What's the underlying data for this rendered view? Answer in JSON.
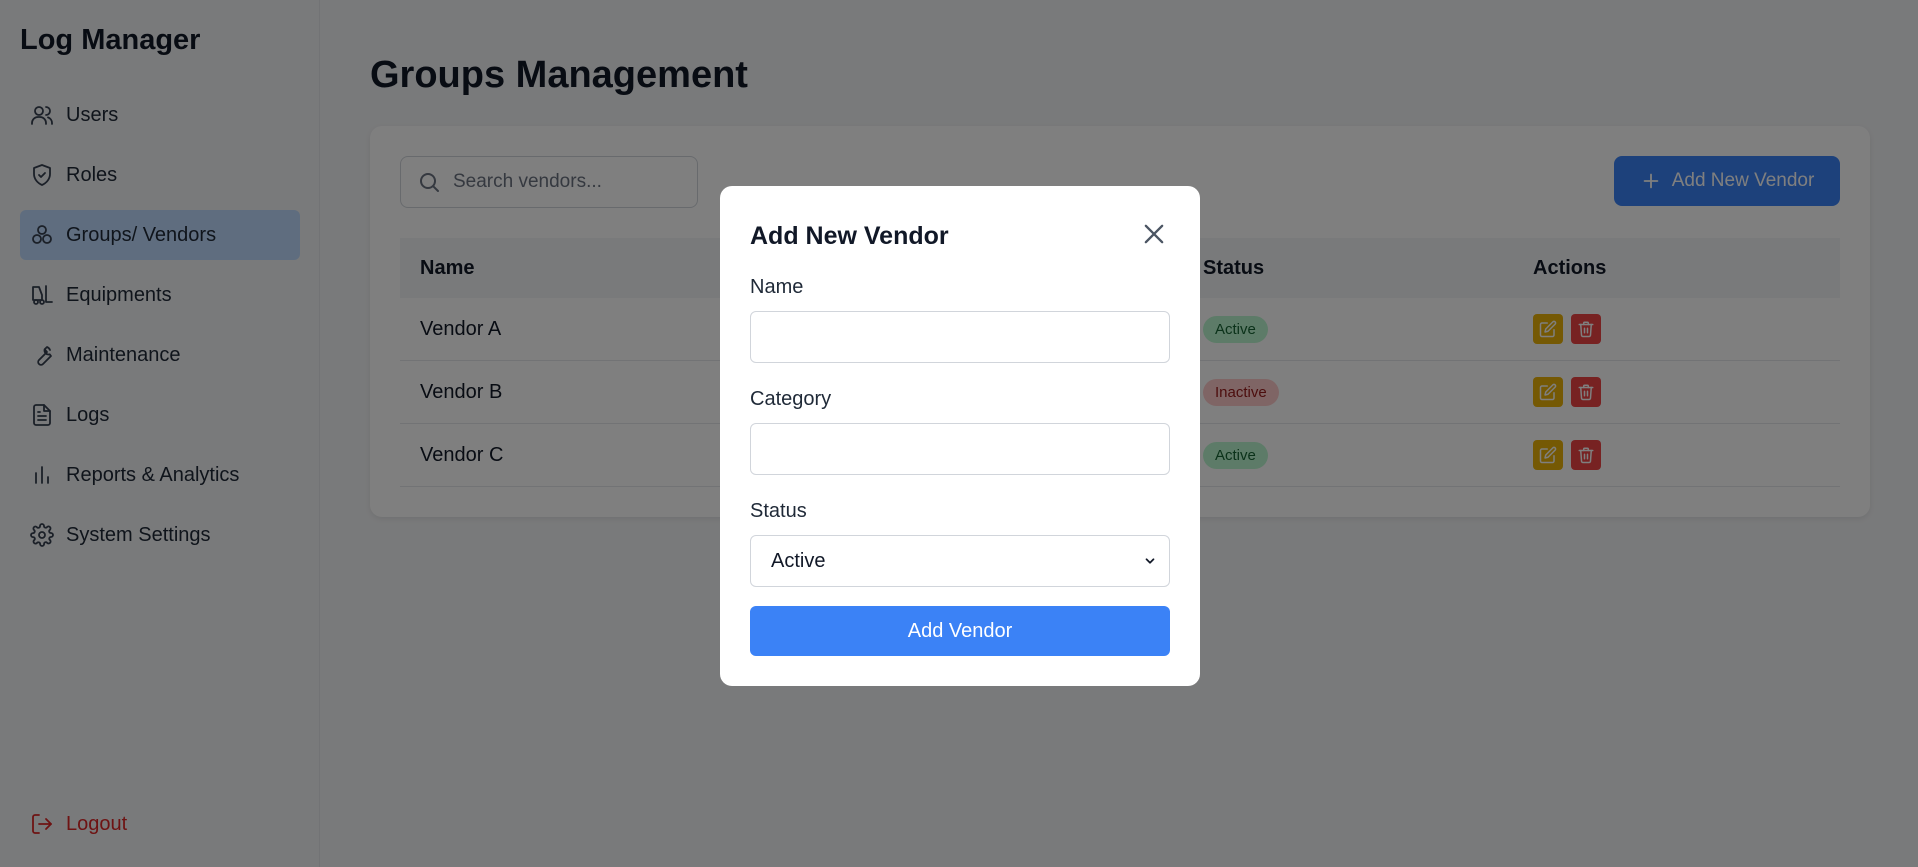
{
  "app": {
    "title": "Log Manager"
  },
  "sidebar": {
    "items": [
      {
        "label": "Users",
        "icon": "users-icon"
      },
      {
        "label": "Roles",
        "icon": "shield-icon"
      },
      {
        "label": "Groups/ Vendors",
        "icon": "groups-icon",
        "active": true
      },
      {
        "label": "Equipments",
        "icon": "forklift-icon"
      },
      {
        "label": "Maintenance",
        "icon": "wrench-icon"
      },
      {
        "label": "Logs",
        "icon": "file-text-icon"
      },
      {
        "label": "Reports & Analytics",
        "icon": "bar-chart-icon"
      },
      {
        "label": "System Settings",
        "icon": "gear-icon"
      }
    ],
    "logout_label": "Logout"
  },
  "main": {
    "title": "Groups Management",
    "search": {
      "placeholder": "Search vendors..."
    },
    "add_button_label": "Add New Vendor",
    "table": {
      "headers": {
        "name": "Name",
        "status": "Status",
        "actions": "Actions"
      },
      "rows": [
        {
          "name": "Vendor A",
          "status": "Active"
        },
        {
          "name": "Vendor B",
          "status": "Inactive"
        },
        {
          "name": "Vendor C",
          "status": "Active"
        }
      ]
    }
  },
  "modal": {
    "title": "Add New Vendor",
    "name_label": "Name",
    "name_value": "",
    "category_label": "Category",
    "category_value": "",
    "status_label": "Status",
    "status_value": "Active",
    "submit_label": "Add Vendor"
  },
  "colors": {
    "primary": "#3b82f6",
    "active_nav": "#bfdbfe",
    "logout": "#dc2626",
    "badge_active_bg": "#bbf7d0",
    "badge_inactive_bg": "#fecaca",
    "edit_button": "#eab308",
    "delete_button": "#ef4444"
  }
}
